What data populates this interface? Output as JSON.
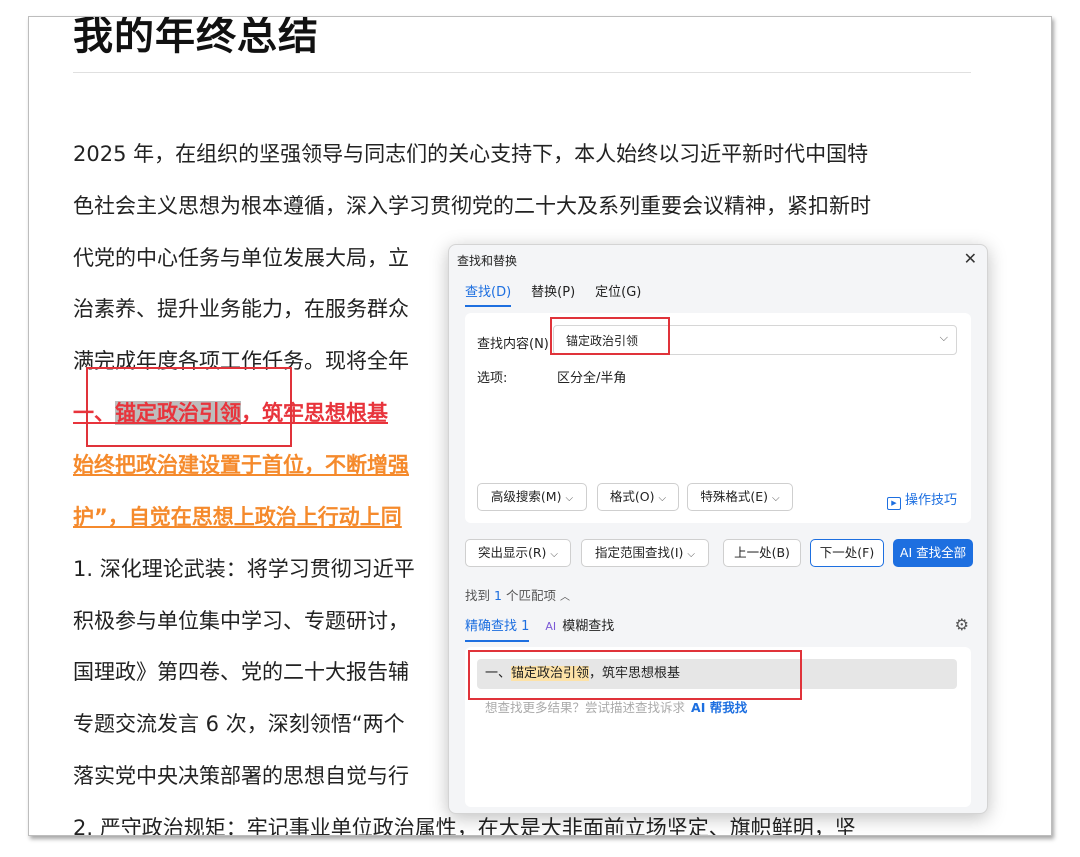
{
  "document": {
    "title": "我的年终总结",
    "lines": [
      "2025 年，在组织的坚强领导与同志们的关心支持下，本人始终以习近平新时代中国特",
      "色社会主义思想为根本遵循，深入学习贯彻党的二十大及系列重要会议精神，紧扣新时",
      "代党的中心任务与单位发展大局，立",
      "治素养、提升业务能力，在服务群众",
      "满完成年度各项工作任务。现将全年"
    ],
    "heading1_prefix": "一、",
    "heading1_match": "锚定政治引领",
    "heading1_rest": "，筑牢思想根基",
    "orange_line1": "始终把政治建设置于首位，不断增强",
    "orange_line2": "护”，自觉在思想上政治上行动上同",
    "body_lines": [
      "1. 深化理论武装：将学习贯彻习近平",
      "积极参与单位集中学习、专题研讨，",
      "国理政》第四卷、党的二十大报告辅",
      "专题交流发言 6 次，深刻领悟“两个",
      "落实党中央决策部署的思想自觉与行",
      "2. 严守政治规矩：牢记事业单位政治属性，在大是大非面前立场坚定、旗帜鲜明，坚"
    ]
  },
  "dialog": {
    "title": "查找和替换",
    "close": "✕",
    "tabs": [
      "查找(D)",
      "替换(P)",
      "定位(G)"
    ],
    "find_label": "查找内容(N)",
    "find_value": "锚定政治引领",
    "options_label": "选项:",
    "options_value": "区分全/半角",
    "buttons_row1": [
      "高级搜索(M)",
      "格式(O)",
      "特殊格式(E)"
    ],
    "tips": "操作技巧",
    "buttons_row2": [
      "突出显示(R)",
      "指定范围查找(I)",
      "上一处(B)",
      "下一处(F)",
      "AI 查找全部"
    ],
    "found_prefix": "找到",
    "found_count": "1",
    "found_suffix": "个匹配项",
    "subtab_exact": "精确查找 1",
    "subtab_fuzzy_ai": "AI",
    "subtab_fuzzy": "模糊查找",
    "result_prefix": "一、",
    "result_match": "锚定政治引领",
    "result_rest": "，筑牢思想根基",
    "hint": "想查找更多结果？尝试描述查找诉求",
    "ai_help": "AI 帮我找"
  },
  "colors": {
    "accent": "#1d6fe0",
    "heading_red": "#e8343c",
    "orange": "#f58a2c",
    "annotation_red": "#e0333a"
  }
}
